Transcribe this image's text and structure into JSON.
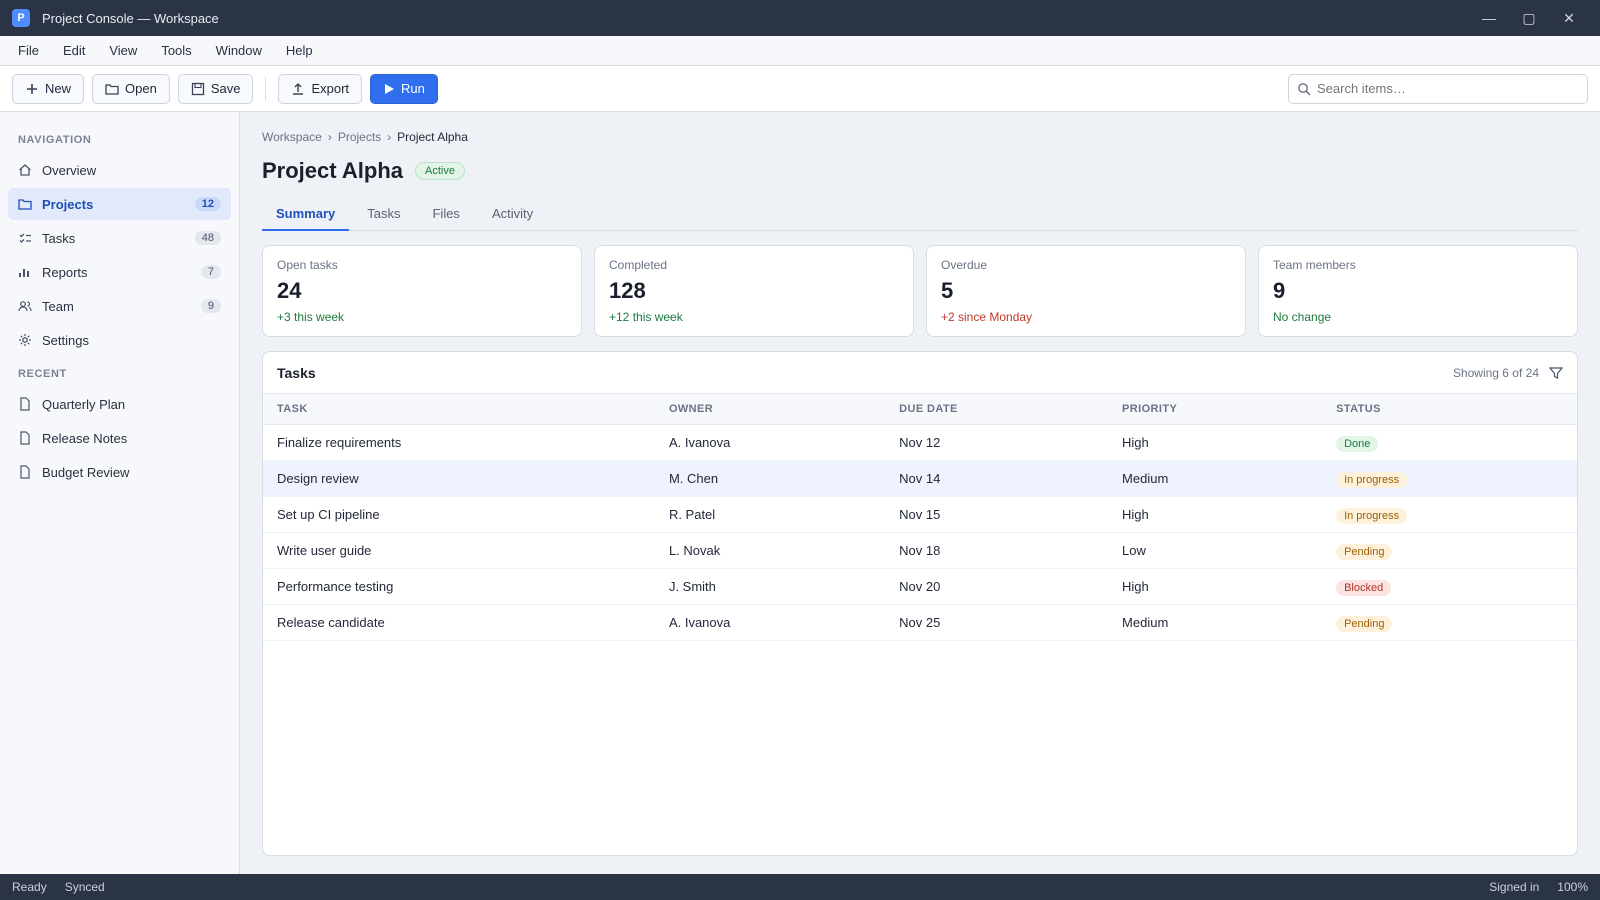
{
  "window": {
    "title": "Project Console — Workspace",
    "logo_letter": "P",
    "controls": {
      "minimize": "—",
      "maximize": "▢",
      "close": "✕"
    }
  },
  "menu": {
    "items": [
      "File",
      "Edit",
      "View",
      "Tools",
      "Window",
      "Help"
    ]
  },
  "toolbar": {
    "new_label": "New",
    "open_label": "Open",
    "save_label": "Save",
    "export_label": "Export",
    "run_label": "Run",
    "search_placeholder": "Search items…"
  },
  "sidebar": {
    "heading": "NAVIGATION",
    "items": [
      {
        "label": "Overview",
        "count": ""
      },
      {
        "label": "Projects",
        "count": "12"
      },
      {
        "label": "Tasks",
        "count": "48"
      },
      {
        "label": "Reports",
        "count": "7"
      },
      {
        "label": "Team",
        "count": "9"
      },
      {
        "label": "Settings",
        "count": ""
      }
    ],
    "heading2": "RECENT",
    "recent": [
      {
        "label": "Quarterly Plan"
      },
      {
        "label": "Release Notes"
      },
      {
        "label": "Budget Review"
      }
    ]
  },
  "breadcrumb": {
    "root": "Workspace",
    "sep": "›",
    "section": "Projects",
    "current": "Project Alpha"
  },
  "page": {
    "title": "Project Alpha",
    "status": "Active"
  },
  "tabs": [
    "Summary",
    "Tasks",
    "Files",
    "Activity"
  ],
  "stats": [
    {
      "label": "Open tasks",
      "value": "24",
      "delta": "+3 this week",
      "negative": false
    },
    {
      "label": "Completed",
      "value": "128",
      "delta": "+12 this week",
      "negative": false
    },
    {
      "label": "Overdue",
      "value": "5",
      "delta": "+2 since Monday",
      "negative": true
    },
    {
      "label": "Team members",
      "value": "9",
      "delta": "No change",
      "negative": false
    }
  ],
  "table": {
    "title": "Tasks",
    "meta": "Showing 6 of 24",
    "columns": [
      "TASK",
      "OWNER",
      "DUE DATE",
      "PRIORITY",
      "STATUS"
    ],
    "rows": [
      [
        "Finalize requirements",
        "A. Ivanova",
        "Nov 12",
        "High",
        "Done"
      ],
      [
        "Design review",
        "M. Chen",
        "Nov 14",
        "Medium",
        "In progress"
      ],
      [
        "Set up CI pipeline",
        "R. Patel",
        "Nov 15",
        "High",
        "In progress"
      ],
      [
        "Write user guide",
        "L. Novak",
        "Nov 18",
        "Low",
        "Pending"
      ],
      [
        "Performance testing",
        "J. Smith",
        "Nov 20",
        "High",
        "Blocked"
      ],
      [
        "Release candidate",
        "A. Ivanova",
        "Nov 25",
        "Medium",
        "Pending"
      ]
    ],
    "status_kind": [
      "ok",
      "warn",
      "warn",
      "warn",
      "err",
      "warn"
    ]
  },
  "statusbar": {
    "left": "Ready",
    "sync": "Synced",
    "user": "Signed in",
    "zoom": "100%"
  },
  "colors": {
    "accent": "#2f6fed",
    "titlebar": "#2b3445",
    "success": "#1e7a3e",
    "danger": "#c0392b"
  }
}
